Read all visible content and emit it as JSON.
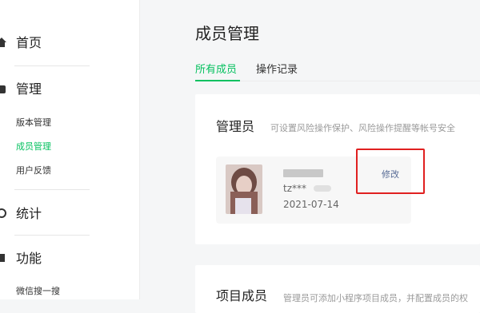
{
  "sidebar": {
    "home": "首页",
    "manage": "管理",
    "manage_items": [
      "版本管理",
      "成员管理",
      "用户反馈"
    ],
    "stats": "统计",
    "features": "功能",
    "feature_items": [
      "微信搜一搜"
    ]
  },
  "main": {
    "title": "成员管理",
    "tabs": [
      "所有成员",
      "操作记录"
    ],
    "admin": {
      "title": "管理员",
      "desc": "可设置风险操作保护、风险操作提醒等帐号安全",
      "account": "tz***",
      "date": "2021-07-14",
      "edit_label": "修改"
    },
    "members": {
      "title": "项目成员",
      "desc": "管理员可添加小程序项目成员，并配置成员的权"
    }
  },
  "colors": {
    "accent": "#07c160",
    "link": "#576b95",
    "highlight": "#e02020"
  }
}
